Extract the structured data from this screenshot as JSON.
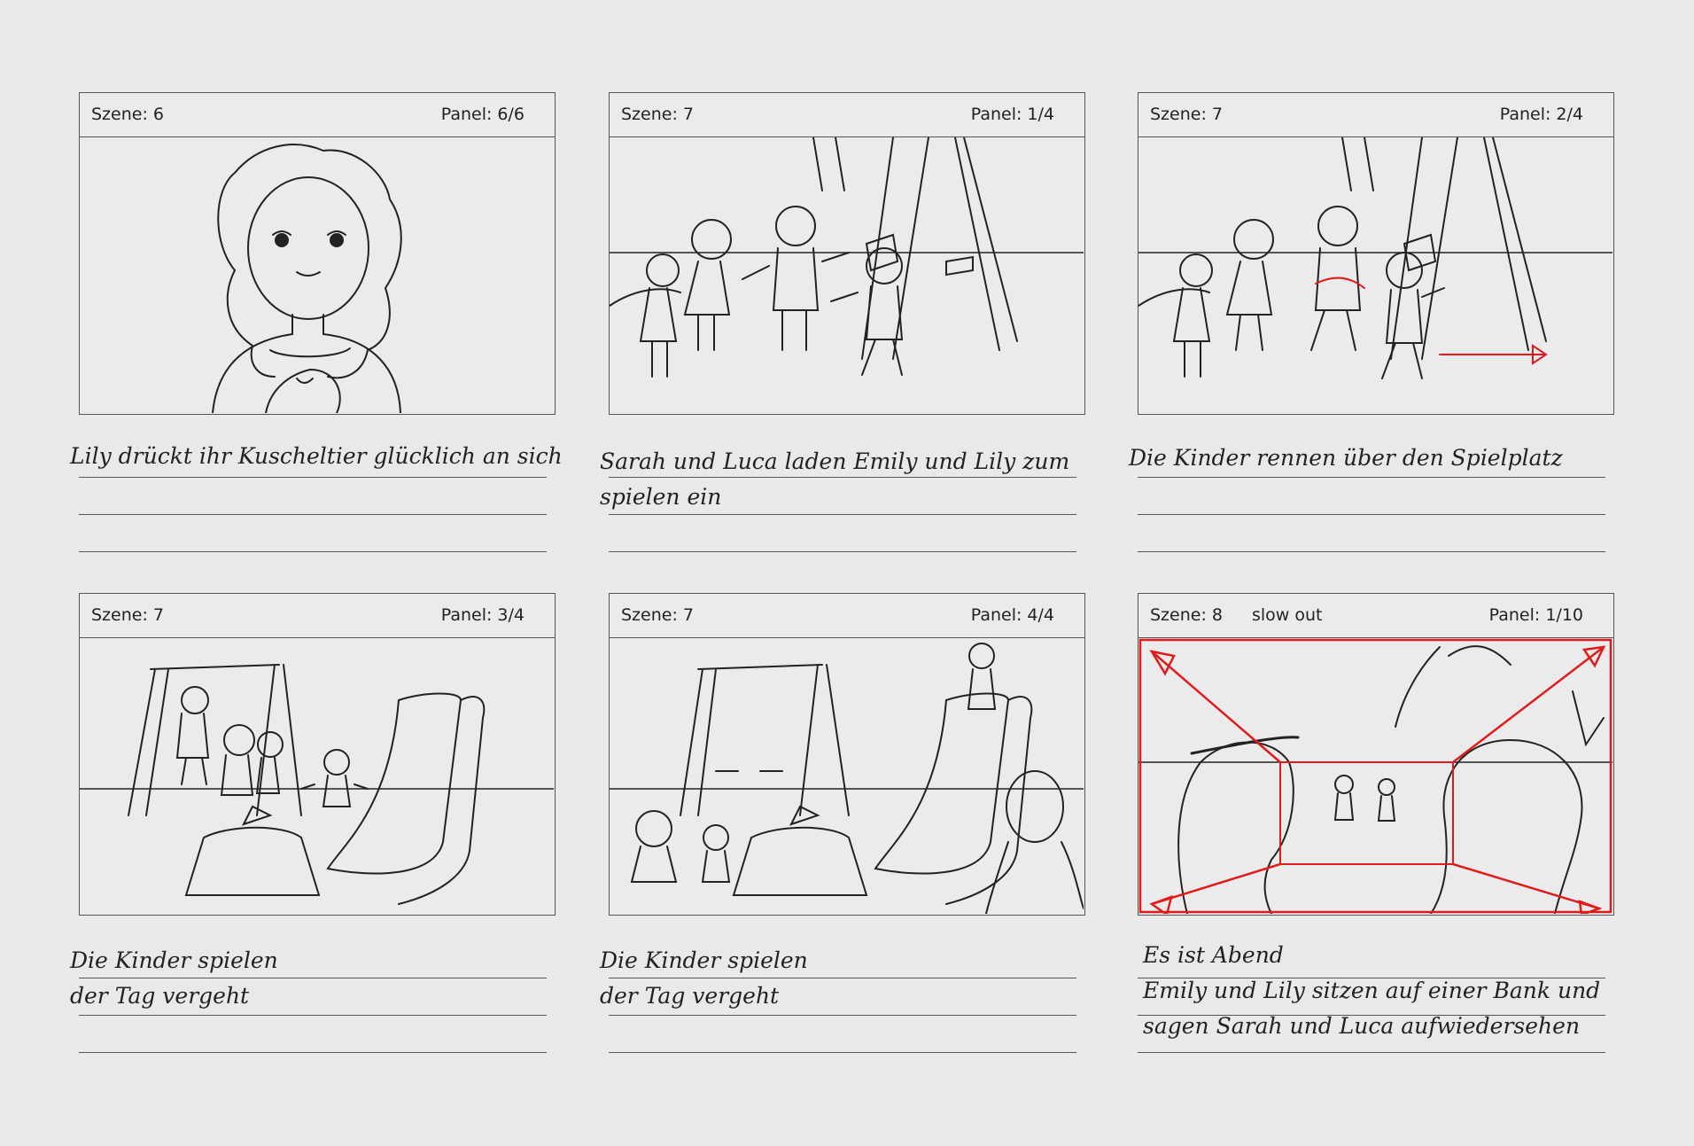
{
  "panels": [
    {
      "scene": "Szene: 6",
      "note": "",
      "panel": "Panel: 6/6",
      "caption": [
        "Lily drückt ihr Kuscheltier glücklich an sich"
      ]
    },
    {
      "scene": "Szene: 7",
      "note": "",
      "panel": "Panel: 1/4",
      "caption": [
        "Sarah und Luca laden Emily und Lily zum",
        "spielen ein"
      ]
    },
    {
      "scene": "Szene: 7",
      "note": "",
      "panel": "Panel: 2/4",
      "caption": [
        "Die Kinder rennen über den Spielplatz"
      ]
    },
    {
      "scene": "Szene: 7",
      "note": "",
      "panel": "Panel: 3/4",
      "caption": [
        "Die Kinder spielen",
        "der Tag vergeht"
      ]
    },
    {
      "scene": "Szene:  7",
      "note": "",
      "panel": "Panel: 4/4",
      "caption": [
        "Die Kinder spielen",
        "der Tag vergeht"
      ]
    },
    {
      "scene": "Szene: 8",
      "note": "slow out",
      "panel": "Panel: 1/10",
      "caption": [
        "Es ist Abend",
        "Emily und Lily sitzen auf einer Bank und",
        "sagen Sarah und Luca aufwiedersehen"
      ]
    }
  ],
  "colors": {
    "background": "#e9e9e9",
    "ink": "#222222",
    "annotation": "#e01b1b"
  }
}
